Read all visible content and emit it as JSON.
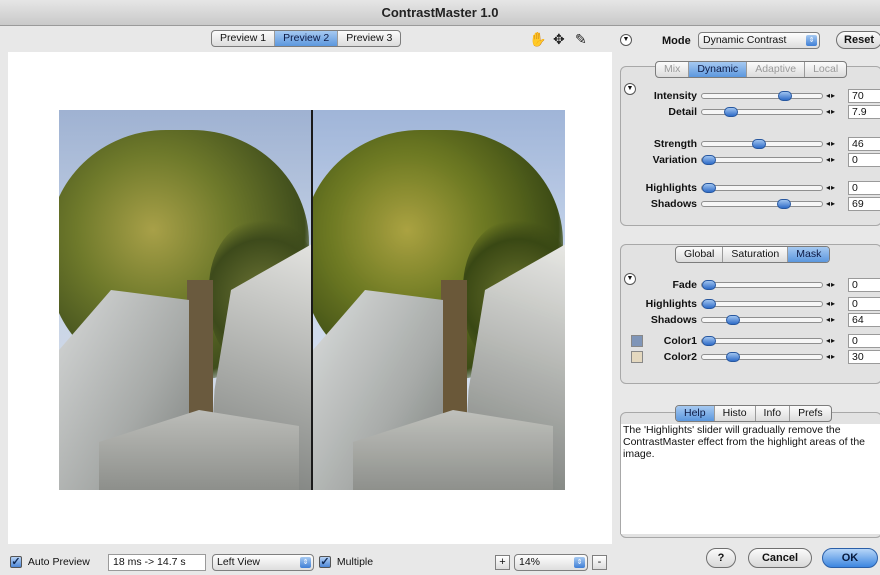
{
  "window": {
    "title": "ContrastMaster 1.0"
  },
  "preview_tabs": [
    {
      "label": "Preview 1",
      "active": false
    },
    {
      "label": "Preview 2",
      "active": true
    },
    {
      "label": "Preview 3",
      "active": false
    }
  ],
  "toolbar_icons": [
    "hand-icon",
    "move-icon",
    "eyedropper-icon"
  ],
  "mode": {
    "label": "Mode",
    "value": "Dynamic Contrast",
    "reset_label": "Reset"
  },
  "mode_tabs": [
    {
      "label": "Mix",
      "state": "dim"
    },
    {
      "label": "Dynamic",
      "state": "active"
    },
    {
      "label": "Adaptive",
      "state": "dim"
    },
    {
      "label": "Local",
      "state": "dim"
    }
  ],
  "dynamic_sliders": [
    {
      "label": "Intensity",
      "value": "70",
      "level": 0.7
    },
    {
      "label": "Detail",
      "value": "7.9",
      "level": 0.2
    },
    {
      "label": "Strength",
      "value": "46",
      "level": 0.46
    },
    {
      "label": "Variation",
      "value": "0",
      "level": 0.0
    },
    {
      "label": "Highlights",
      "value": "0",
      "level": 0.0
    },
    {
      "label": "Shadows",
      "value": "69",
      "level": 0.69
    }
  ],
  "mask_tabs": [
    {
      "label": "Global",
      "state": "normal"
    },
    {
      "label": "Saturation",
      "state": "normal"
    },
    {
      "label": "Mask",
      "state": "active"
    }
  ],
  "mask_sliders": [
    {
      "label": "Fade",
      "value": "0",
      "level": 0.0
    },
    {
      "label": "Highlights",
      "value": "0",
      "level": 0.0
    },
    {
      "label": "Shadows",
      "value": "64",
      "level": 0.22
    },
    {
      "label": "Color1",
      "value": "0",
      "level": 0.0,
      "swatch": "#7f95b8"
    },
    {
      "label": "Color2",
      "value": "30",
      "level": 0.22,
      "swatch": "#e4d8bf"
    }
  ],
  "info_tabs": [
    {
      "label": "Help",
      "state": "active"
    },
    {
      "label": "Histo",
      "state": "normal"
    },
    {
      "label": "Info",
      "state": "normal"
    },
    {
      "label": "Prefs",
      "state": "normal"
    }
  ],
  "help_text": "The 'Highlights' slider will gradually remove the ContrastMaster effect from the highlight areas of the image.",
  "bottom": {
    "auto_preview_label": "Auto Preview",
    "auto_preview_checked": true,
    "timing": "18 ms -> 14.7 s",
    "view_select": "Left View",
    "multiple_label": "Multiple",
    "multiple_checked": true,
    "zoom_plus": "+",
    "zoom_value": "14%",
    "zoom_minus": "-"
  },
  "buttons": {
    "help": "?",
    "cancel": "Cancel",
    "ok": "OK"
  }
}
